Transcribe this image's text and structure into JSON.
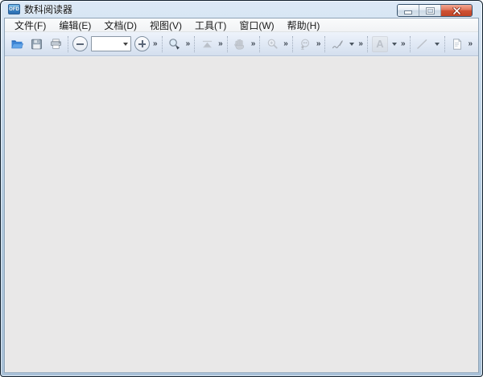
{
  "window": {
    "title": "数科阅读器",
    "app_icon_label": "OFD",
    "controls": [
      {
        "name": "minimize"
      },
      {
        "name": "maximize"
      },
      {
        "name": "close"
      }
    ]
  },
  "menu_bar": {
    "items": [
      {
        "label": "文件(F)"
      },
      {
        "label": "编辑(E)"
      },
      {
        "label": "文档(D)"
      },
      {
        "label": "视图(V)"
      },
      {
        "label": "工具(T)"
      },
      {
        "label": "窗口(W)"
      },
      {
        "label": "帮助(H)"
      }
    ]
  },
  "toolbar": {
    "overflow_glyph": "»",
    "text_tool_label": "A",
    "zoom_combo": {
      "value": "",
      "placeholder": ""
    },
    "tools": [
      {
        "icon": "open-folder-icon",
        "enabled": true
      },
      {
        "icon": "save-icon",
        "enabled": true
      },
      {
        "icon": "print-icon",
        "enabled": true
      },
      {
        "icon": "zoom-out-icon",
        "enabled": true
      },
      {
        "icon": "zoom-level-combobox",
        "enabled": true
      },
      {
        "icon": "zoom-in-icon",
        "enabled": true
      },
      {
        "icon": "zoom-select-icon",
        "enabled": true
      },
      {
        "icon": "fit-page-icon",
        "enabled": false
      },
      {
        "icon": "hand-pan-icon",
        "enabled": false
      },
      {
        "icon": "marquee-zoom-icon",
        "enabled": false
      },
      {
        "icon": "read-mode-icon",
        "enabled": false
      },
      {
        "icon": "signature-pen-icon",
        "enabled": false
      },
      {
        "icon": "text-annotation-icon",
        "enabled": false
      },
      {
        "icon": "line-annotation-icon",
        "enabled": false
      },
      {
        "icon": "note-annotation-icon",
        "enabled": true
      }
    ]
  },
  "colors": {
    "frame_outer": "#10202e",
    "frame_glass_light": "#dce9f6",
    "frame_glass_dark": "#a9c1d8",
    "menu_bar_bg": "#f7f8fa",
    "toolbar_bg_top": "#eef3fb",
    "toolbar_bg_bottom": "#d4dfee",
    "client_bg": "#e9e8e8",
    "close_button_red": "#cf5336",
    "folder_blue": "#3d86d8"
  }
}
